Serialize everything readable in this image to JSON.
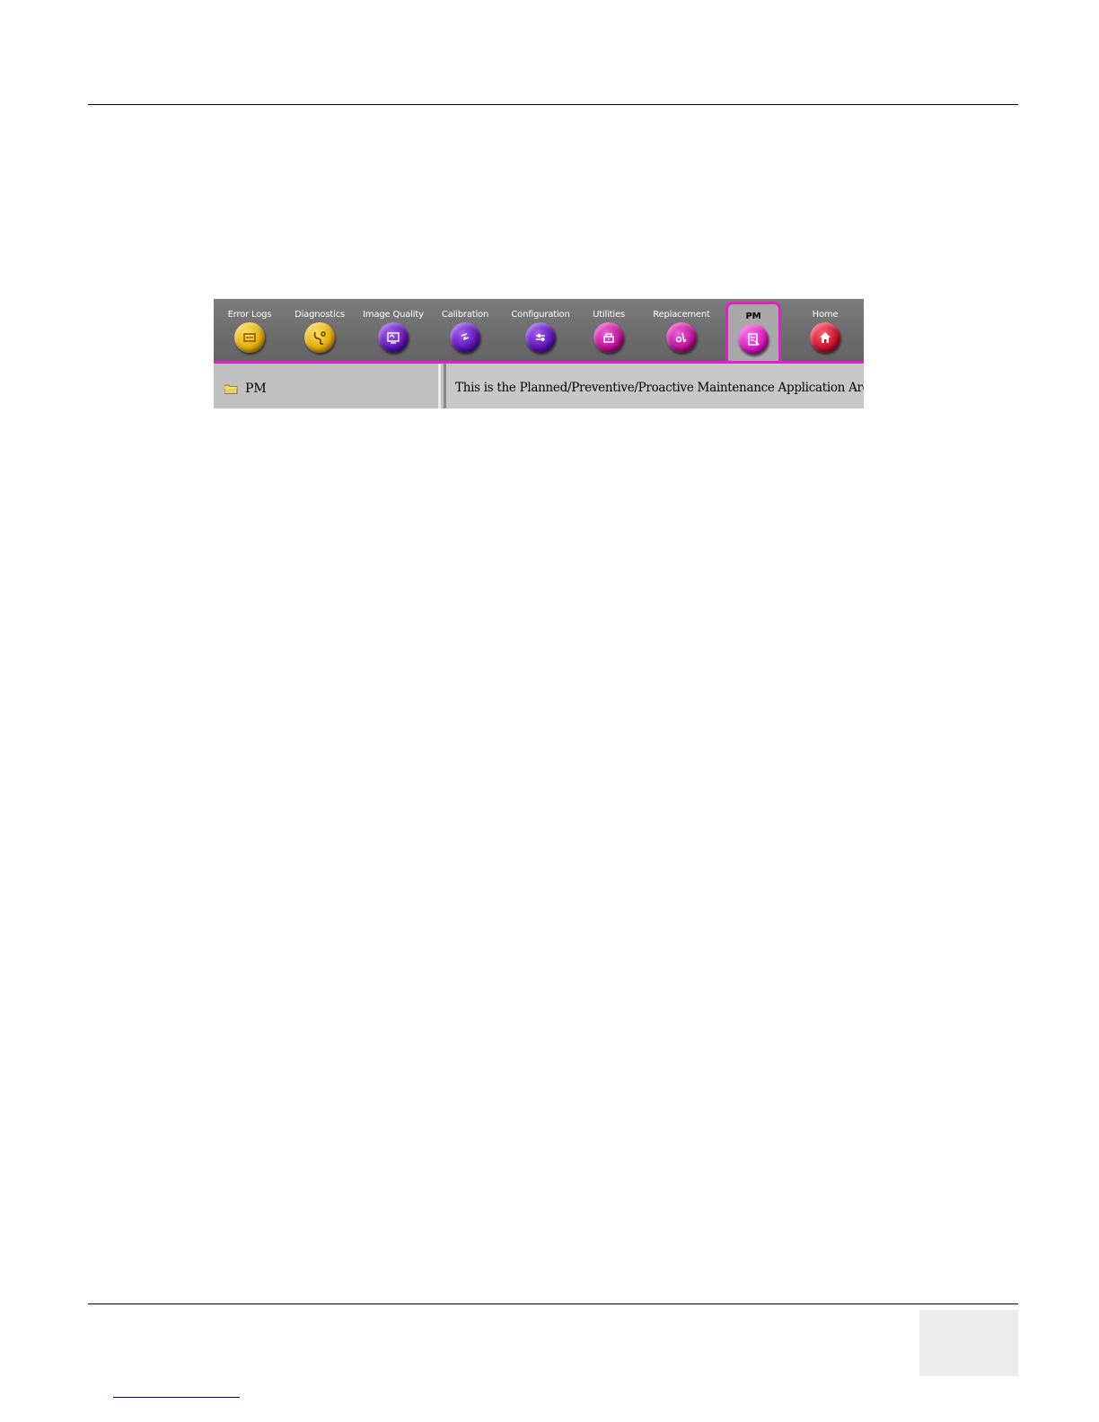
{
  "toolbar": {
    "tabs": [
      {
        "label": "Error Logs",
        "icon": "error-logs-icon",
        "color": "#e8b800"
      },
      {
        "label": "Diagnostics",
        "icon": "stethoscope-icon",
        "color": "#e8b800"
      },
      {
        "label": "Image Quality",
        "icon": "image-quality-icon",
        "color": "#6a1ab8"
      },
      {
        "label": "Calibration",
        "icon": "calibration-icon",
        "color": "#6a1ab8"
      },
      {
        "label": "Configuration",
        "icon": "configuration-icon",
        "color": "#6a1ab8"
      },
      {
        "label": "Utilities",
        "icon": "utilities-icon",
        "color": "#c0169a"
      },
      {
        "label": "Replacement",
        "icon": "replacement-icon",
        "color": "#c0169a"
      },
      {
        "label": "PM",
        "icon": "pm-clipboard-icon",
        "color": "#d020c0",
        "active": true
      },
      {
        "label": "Home",
        "icon": "home-icon",
        "color": "#cc1030"
      }
    ],
    "accent_color": "#e020c8"
  },
  "tree": {
    "items": [
      {
        "label": "PM",
        "icon": "folder-icon"
      }
    ]
  },
  "main": {
    "message": "This is the Planned/Preventive/Proactive Maintenance Application Area!"
  }
}
